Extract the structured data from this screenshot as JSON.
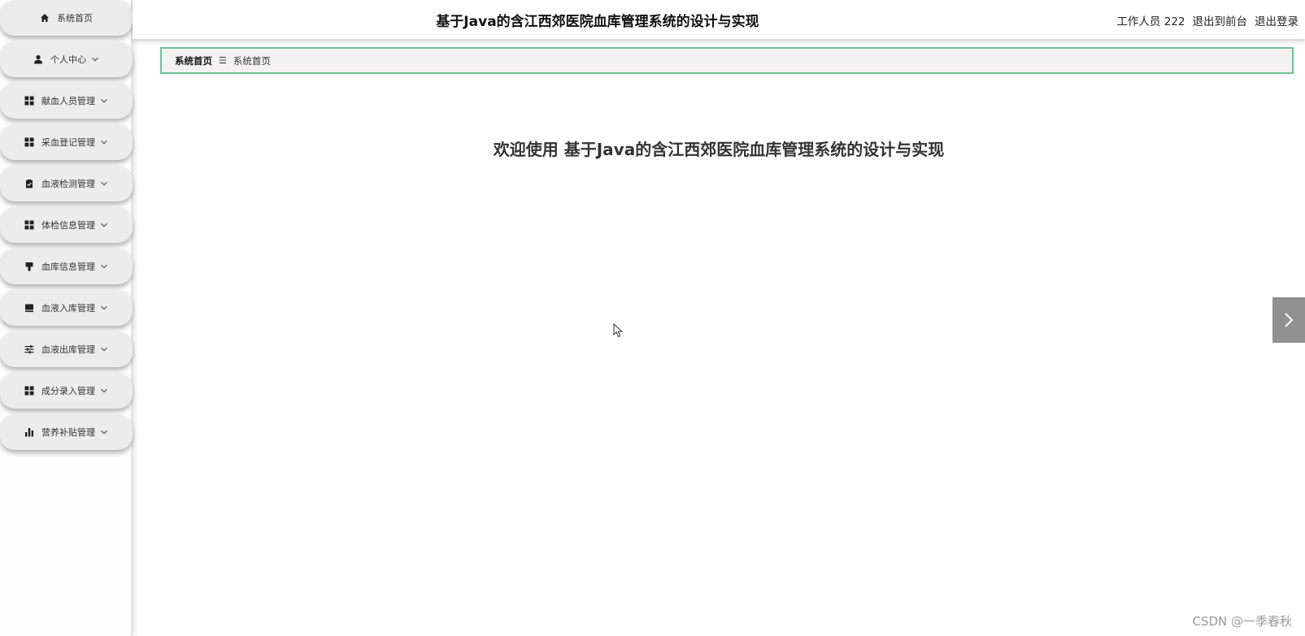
{
  "header": {
    "title": "基于Java的含江西郊医院血库管理系统的设计与实现",
    "user_label": "工作人员 222",
    "front_link": "退出到前台",
    "logout_link": "退出登录"
  },
  "sidebar": {
    "items": [
      {
        "label": "系统首页",
        "icon": "home-icon"
      },
      {
        "label": "个人中心",
        "icon": "user-icon"
      },
      {
        "label": "献血人员管理",
        "icon": "grid-icon"
      },
      {
        "label": "采血登记管理",
        "icon": "grid-icon"
      },
      {
        "label": "血液检测管理",
        "icon": "clipboard-icon"
      },
      {
        "label": "体检信息管理",
        "icon": "grid-icon"
      },
      {
        "label": "血库信息管理",
        "icon": "brush-icon"
      },
      {
        "label": "血液入库管理",
        "icon": "inbox-icon"
      },
      {
        "label": "血液出库管理",
        "icon": "sliders-icon"
      },
      {
        "label": "成分录入管理",
        "icon": "grid-icon"
      },
      {
        "label": "营养补贴管理",
        "icon": "bar-chart-icon"
      }
    ]
  },
  "breadcrumb": {
    "root": "系统首页",
    "separator": "☰",
    "current": "系统首页"
  },
  "main": {
    "welcome": "欢迎使用 基于Java的含江西郊医院血库管理系统的设计与实现"
  },
  "watermark": "CSDN @一季春秋",
  "colors": {
    "accent_border": "#6cc39a",
    "sidebar_item": "#ececec",
    "toggle": "#909090"
  }
}
